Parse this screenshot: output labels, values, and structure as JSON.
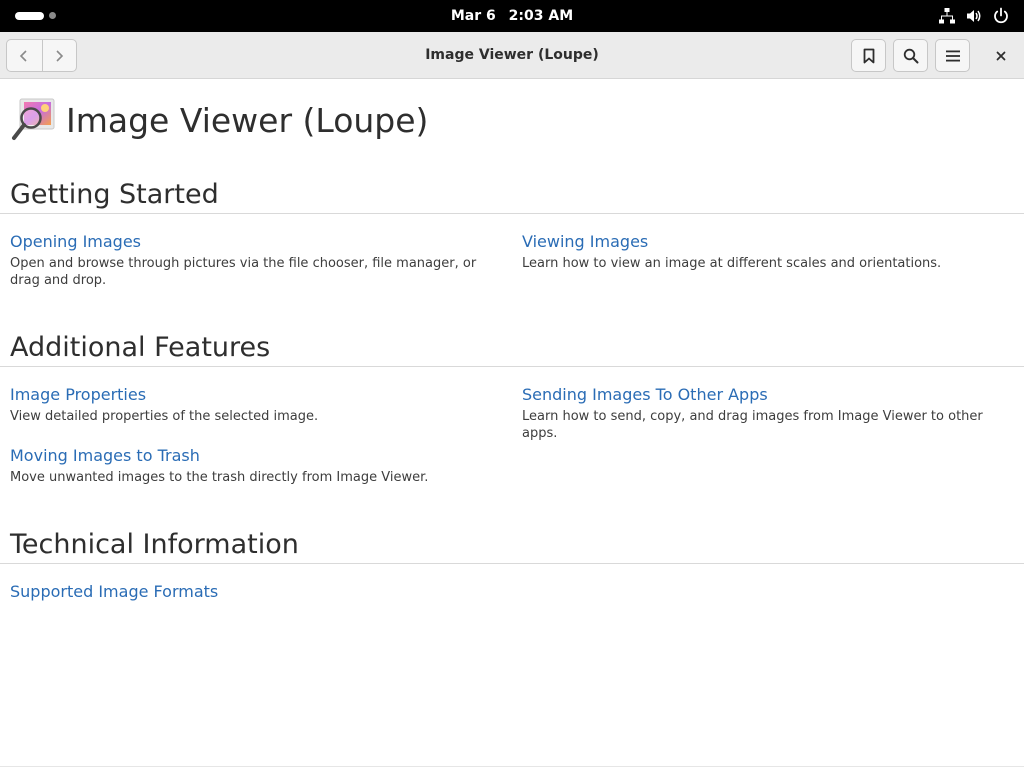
{
  "topbar": {
    "date": "Mar 6",
    "time": "2:03 AM",
    "tray_icons": [
      "network-icon",
      "volume-icon",
      "power-icon"
    ]
  },
  "headerbar": {
    "title": "Image Viewer (Loupe)",
    "icons": [
      "back-arrow-icon",
      "forward-arrow-icon",
      "bookmark-icon",
      "search-icon",
      "hamburger-menu-icon",
      "close-icon"
    ]
  },
  "page": {
    "title": "Image Viewer (Loupe)",
    "sections": [
      {
        "title": "Getting Started",
        "items": [
          {
            "link": "Opening Images",
            "desc": "Open and browse through pictures via the file chooser, file manager, or drag and drop."
          },
          {
            "link": "Viewing Images",
            "desc": "Learn how to view an image at different scales and orientations."
          }
        ]
      },
      {
        "title": "Additional Features",
        "items": [
          {
            "link": "Image Properties",
            "desc": "View detailed properties of the selected image."
          },
          {
            "link": "Sending Images To Other Apps",
            "desc": "Learn how to send, copy, and drag images from Image Viewer to other apps."
          },
          {
            "link": "Moving Images to Trash",
            "desc": "Move unwanted images to the trash directly from Image Viewer."
          }
        ]
      },
      {
        "title": "Technical Information",
        "items": [
          {
            "link": "Supported Image Formats"
          }
        ]
      }
    ]
  },
  "colors": {
    "link": "#2a6cb5",
    "topbar_bg": "#000000",
    "headerbar_bg": "#ebebeb"
  }
}
